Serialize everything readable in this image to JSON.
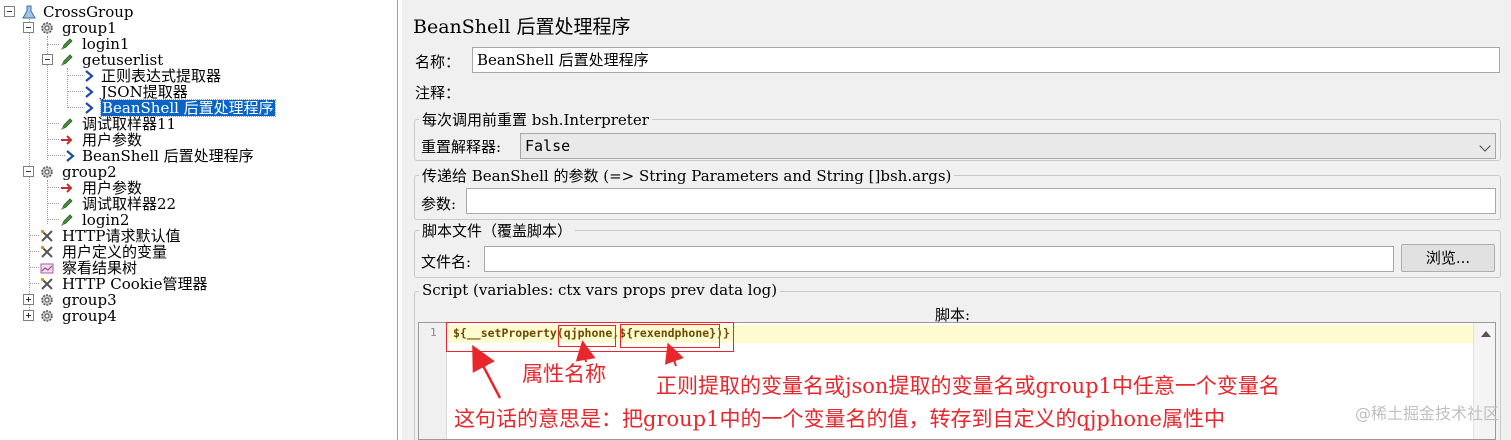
{
  "tree": {
    "nodes": [
      {
        "label": "CrossGroup",
        "icon": "test-plan-icon"
      },
      {
        "label": "group1",
        "icon": "thread-group-gear-icon"
      },
      {
        "label": "login1",
        "icon": "http-sampler-pencil-icon"
      },
      {
        "label": "getuserlist",
        "icon": "http-sampler-pencil-icon"
      },
      {
        "label": "正则表达式提取器",
        "icon": "post-processor-arrow-icon"
      },
      {
        "label": "JSON提取器",
        "icon": "post-processor-arrow-icon"
      },
      {
        "label": "BeanShell 后置处理程序",
        "icon": "post-processor-arrow-icon"
      },
      {
        "label": "调试取样器11",
        "icon": "http-sampler-pencil-icon"
      },
      {
        "label": "用户参数",
        "icon": "pre-processor-arrow-icon"
      },
      {
        "label": "BeanShell 后置处理程序",
        "icon": "post-processor-arrow-icon"
      },
      {
        "label": "group2",
        "icon": "thread-group-gear-icon"
      },
      {
        "label": "用户参数",
        "icon": "pre-processor-arrow-icon"
      },
      {
        "label": "调试取样器22",
        "icon": "http-sampler-pencil-icon"
      },
      {
        "label": "login2",
        "icon": "http-sampler-pencil-icon"
      },
      {
        "label": "HTTP请求默认值",
        "icon": "config-wrench-icon"
      },
      {
        "label": "用户定义的变量",
        "icon": "config-wrench-icon"
      },
      {
        "label": "察看结果树",
        "icon": "listener-chart-icon"
      },
      {
        "label": "HTTP Cookie管理器",
        "icon": "config-wrench-icon"
      },
      {
        "label": "group3",
        "icon": "thread-group-gear-icon"
      },
      {
        "label": "group4",
        "icon": "thread-group-gear-icon"
      }
    ]
  },
  "panel": {
    "title": "BeanShell 后置处理程序",
    "name_label": "名称：",
    "name_value": "BeanShell 后置处理程序",
    "comment_label": "注释：",
    "comment_value": "",
    "reset_group_title": "每次调用前重置 bsh.Interpreter",
    "reset_label": "重置解释器:",
    "reset_value": "False",
    "params_group_title": "传递给 BeanShell 的参数 (=> String Parameters and String []bsh.args)",
    "params_label": "参数:",
    "params_value": "",
    "file_group_title": "脚本文件（覆盖脚本）",
    "file_label": "文件名:",
    "file_value": "",
    "browse_label": "浏览...",
    "script_group_title": "Script (variables: ctx vars props prev data log)",
    "script_heading": "脚本:",
    "line_number": "1",
    "code": "${__setProperty(qjphone,${rexendphone})}"
  },
  "annotations": {
    "property_name": "属性名称",
    "variable_source": "正则提取的变量名或json提取的变量名或group1中任意一个变量名",
    "meaning": "这句话的意思是：把group1中的一个变量名的值，转存到自定义的qjphone属性中"
  },
  "watermark": "@稀土掘金技术社区",
  "colors": {
    "selection": "#0a64c8",
    "annotation_red": "#e8262b",
    "current_line": "#fffbd0",
    "panel_bg": "#f0f0f0"
  }
}
